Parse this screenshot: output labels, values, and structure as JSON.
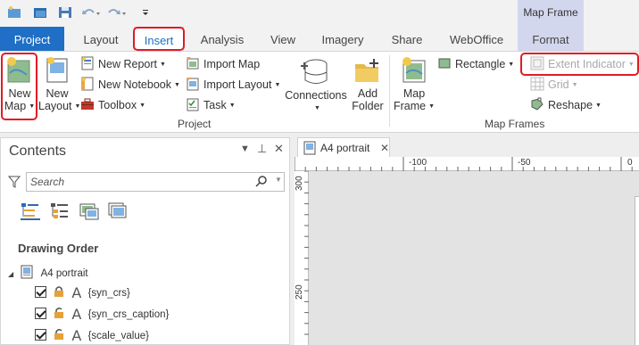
{
  "quick_access": {
    "icons": [
      "new-project-icon",
      "open-project-icon",
      "save-project-icon",
      "undo-icon",
      "redo-icon",
      "customize-toolbar-icon"
    ]
  },
  "contextual_group": {
    "label": "Map Frame"
  },
  "tabs": [
    {
      "label": "Project"
    },
    {
      "label": "Layout"
    },
    {
      "label": "Insert"
    },
    {
      "label": "Analysis"
    },
    {
      "label": "View"
    },
    {
      "label": "Imagery"
    },
    {
      "label": "Share"
    },
    {
      "label": "WebOffice"
    },
    {
      "label": "Format"
    }
  ],
  "ribbon": {
    "new_map": {
      "line1": "New",
      "line2": "Map"
    },
    "new_layout": {
      "line1": "New",
      "line2": "Layout"
    },
    "new_report": "New Report",
    "new_notebook": "New Notebook",
    "toolbox": "Toolbox",
    "import_map": "Import Map",
    "import_layout": "Import Layout",
    "task": "Task",
    "connections": "Connections",
    "add_folder": {
      "line1": "Add",
      "line2": "Folder"
    },
    "project_group_label": "Project",
    "map_frame": {
      "line1": "Map",
      "line2": "Frame"
    },
    "rectangle": "Rectangle",
    "extent_indicator": "Extent Indicator",
    "grid": "Grid",
    "reshape": "Reshape",
    "map_frames_group_label": "Map Frames"
  },
  "contents_pane": {
    "title": "Contents",
    "search_placeholder": "Search",
    "section_heading": "Drawing Order",
    "tree": {
      "root": "A4 portrait",
      "items": [
        {
          "label": "{syn_crs}",
          "checked": true
        },
        {
          "label": "{syn_crs_caption}",
          "checked": true
        },
        {
          "label": "{scale_value}",
          "checked": true
        }
      ]
    }
  },
  "document": {
    "tab_label": "A4 portrait",
    "ruler_top_labels": [
      "-100",
      "-50",
      "0"
    ],
    "ruler_left_labels": [
      "300",
      "250"
    ]
  },
  "colors": {
    "project_tab": "#1e6fc5",
    "contextual_tab": "#d3d7ee",
    "highlight": "#e01b24"
  }
}
